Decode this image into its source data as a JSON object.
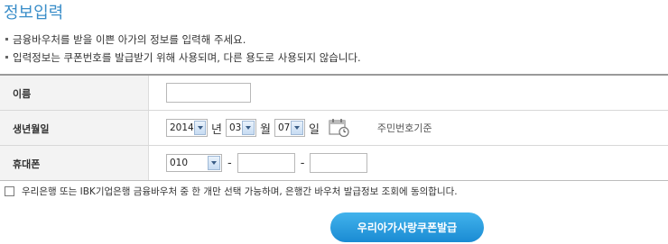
{
  "page_title": "정보입력",
  "notices": [
    "금융바우처를 받을 이쁜 아가의 정보를 입력해 주세요.",
    "입력정보는 쿠폰번호를 발급받기 위해 사용되며, 다른 용도로 사용되지 않습니다."
  ],
  "form": {
    "name": {
      "label": "이름",
      "value": ""
    },
    "birth": {
      "label": "생년월일",
      "year": "2014",
      "year_unit": "년",
      "month": "03",
      "month_unit": "월",
      "day": "07",
      "day_unit": "일",
      "note": "주민번호기준"
    },
    "phone": {
      "label": "휴대폰",
      "prefix": "010",
      "separator": "-",
      "middle": "",
      "last": ""
    }
  },
  "agreement": {
    "text": "우리은행 또는 IBK기업은행 금융바우처 중 한 개만 선택 가능하며, 은행간 바우처 발급정보 조회에 동의합니다.",
    "checked": false
  },
  "submit_label": "우리아가사랑쿠폰발급",
  "colors": {
    "title": "#3a8ec9",
    "button": "#1f95db"
  },
  "icons": {
    "calendar": "calendar-icon",
    "dropdown": "chevron-down-icon"
  }
}
